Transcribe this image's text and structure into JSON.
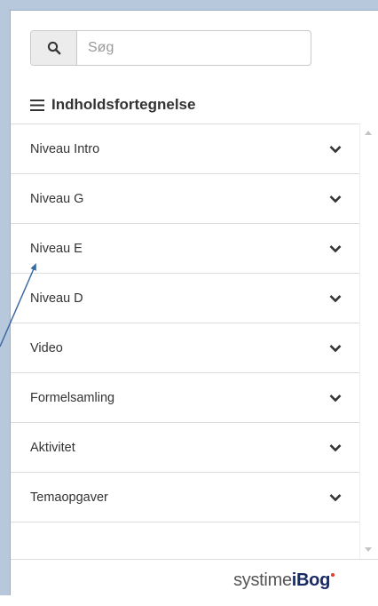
{
  "search": {
    "placeholder": "Søg"
  },
  "toc": {
    "title": "Indholdsfortegnelse",
    "items": [
      {
        "label": "Niveau Intro"
      },
      {
        "label": "Niveau G"
      },
      {
        "label": "Niveau E"
      },
      {
        "label": "Niveau D"
      },
      {
        "label": "Video"
      },
      {
        "label": "Formelsamling"
      },
      {
        "label": "Aktivitet"
      },
      {
        "label": "Temaopgaver"
      }
    ]
  },
  "footer": {
    "brand_prefix": "systime",
    "brand_suffix": "iBog"
  },
  "colors": {
    "frame": "#b8c8dc",
    "arrow": "#3b6aa3",
    "brand": "#1a2b63",
    "brand_dot": "#e63a2e"
  }
}
